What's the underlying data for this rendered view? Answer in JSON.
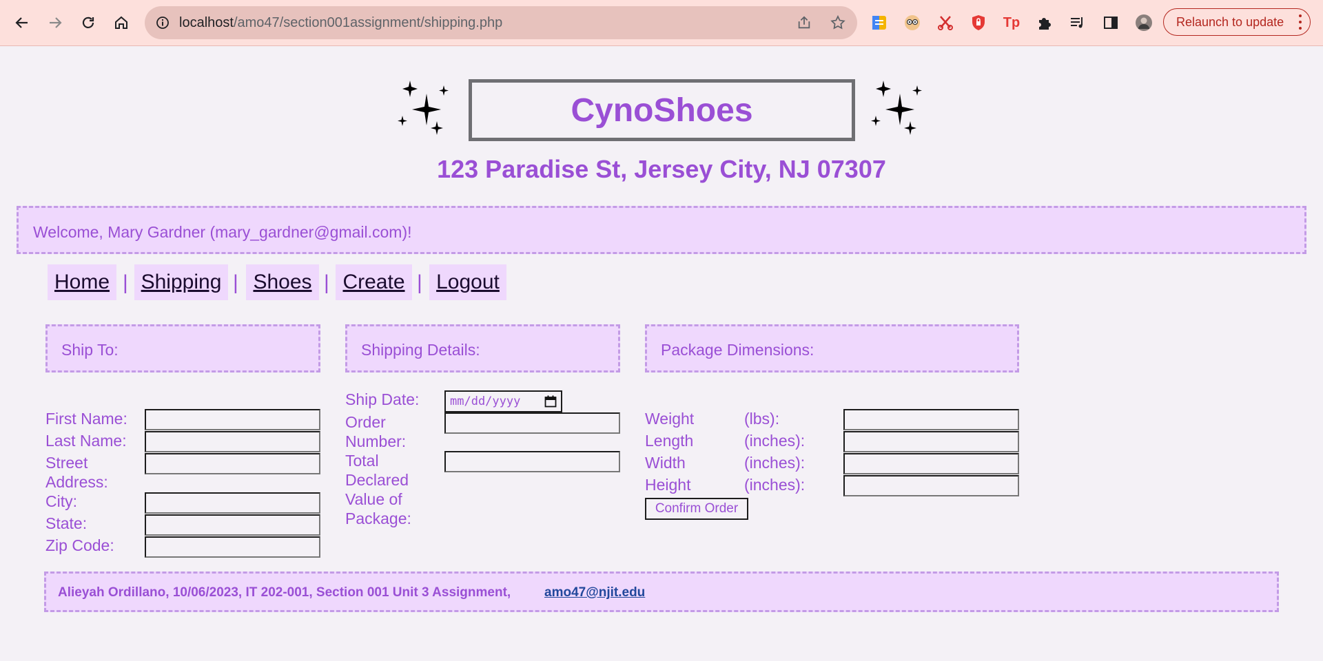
{
  "browser": {
    "url_host": "localhost",
    "url_path": "/amo47/section001assignment/shipping.php",
    "relaunch_label": "Relaunch to update",
    "extension_icons": [
      "notes-extension-icon",
      "eyes-extension-icon",
      "scissors-extension-icon",
      "shield-extension-icon",
      "tp-extension-icon",
      "puzzle-extensions-icon",
      "playlist-icon",
      "side-panel-icon",
      "profile-avatar"
    ],
    "tp_label": "Tp"
  },
  "header": {
    "site_title": "CynoShoes",
    "address": "123 Paradise St, Jersey City, NJ 07307"
  },
  "welcome": "Welcome, Mary Gardner (mary_gardner@gmail.com)!",
  "nav": {
    "items": [
      "Home",
      "Shipping",
      "Shoes",
      "Create",
      "Logout"
    ],
    "separator": "|"
  },
  "sections": {
    "ship_to": "Ship To:",
    "shipping_details": "Shipping Details:",
    "package_dimensions": "Package Dimensions:"
  },
  "ship_to_fields": {
    "first_name": "First Name:",
    "last_name": "Last Name:",
    "street_1": "Street",
    "street_2": "Address:",
    "city": "City:",
    "state": "State:",
    "zip": "Zip Code:"
  },
  "shipping_fields": {
    "ship_date": "Ship Date:",
    "date_placeholder": "mm/dd/yyyy",
    "order_1": "Order",
    "order_2": "Number:",
    "value_1": "Total",
    "value_2": "Declared",
    "value_3": "Value of",
    "value_4": "Package:"
  },
  "dimension_fields": {
    "weight": "Weight",
    "weight_unit": "(lbs):",
    "length": "Length",
    "length_unit": "(inches):",
    "width": "Width",
    "width_unit": "(inches):",
    "height": "Height",
    "height_unit": "(inches):"
  },
  "confirm_label": "Confirm Order",
  "footer": {
    "text": "Alieyah Ordillano, 10/06/2023, IT 202-001, Section 001 Unit 3 Assignment,",
    "email": "amo47@njit.edu"
  },
  "colors": {
    "accent": "#9a4fd5",
    "panel": "#efd8fd",
    "panel_border": "#c39be6",
    "background": "#f4f1f6"
  }
}
